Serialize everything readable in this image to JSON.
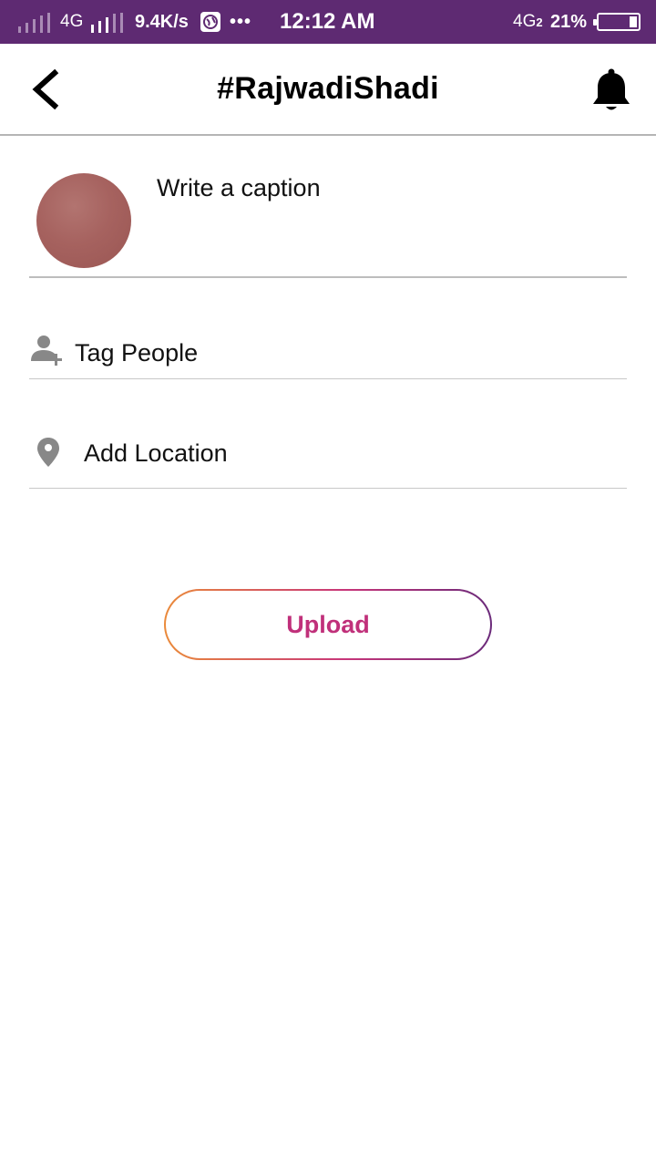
{
  "status_bar": {
    "network_1": "4G",
    "speed": "9.4K/s",
    "dots": "•••",
    "time": "12:12 AM",
    "network_2": "4G",
    "sim_label": "2",
    "battery_percent": "21%",
    "battery_level": 0.21,
    "background_color": "#5e2a72"
  },
  "header": {
    "title": "#RajwadiShadi",
    "back_icon": "chevron-left-icon",
    "notification_icon": "bell-icon"
  },
  "caption": {
    "placeholder": "Write a caption",
    "avatar_color": "#a6625f"
  },
  "options": {
    "tag_people": {
      "label": "Tag People",
      "icon": "add-person-icon"
    },
    "add_location": {
      "label": "Add Location",
      "icon": "location-pin-icon"
    }
  },
  "upload": {
    "label": "Upload",
    "gradient": [
      "#ea8a3a",
      "#c8367a",
      "#6a2a7a"
    ]
  }
}
